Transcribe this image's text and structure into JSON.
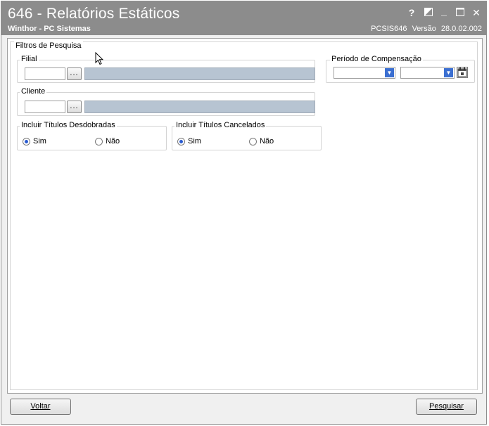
{
  "window": {
    "title": "646 - Relatórios Estáticos",
    "subtitle": "Winthor - PC Sistemas",
    "program_code": "PCSIS646",
    "version_label": "Versão",
    "version_number": "28.0.02.002",
    "controls": {
      "help": "?",
      "minimize": "_",
      "close": "✕"
    }
  },
  "filters": {
    "group_label": "Filtros de Pesquisa",
    "filial": {
      "label": "Filial",
      "code_value": "",
      "dots_label": "...",
      "description": ""
    },
    "cliente": {
      "label": "Cliente",
      "code_value": "",
      "dots_label": "...",
      "description": ""
    },
    "periodo": {
      "label": "Período de Compensação",
      "start_value": "",
      "end_value": ""
    },
    "titulos_desdobrados": {
      "label": "Incluir Títulos Desdobradas",
      "yes_label": "Sim",
      "no_label": "Não",
      "selected": "Sim"
    },
    "titulos_cancelados": {
      "label": "Incluir Títulos Cancelados",
      "yes_label": "Sim",
      "no_label": "Não",
      "selected": "Sim"
    }
  },
  "footer": {
    "back_label": "Voltar",
    "search_label": "Pesquisar"
  },
  "colors": {
    "titlebar": "#8c8c8c",
    "readonly_field": "#b7c4d2",
    "combo_arrow": "#3b6fd1"
  }
}
